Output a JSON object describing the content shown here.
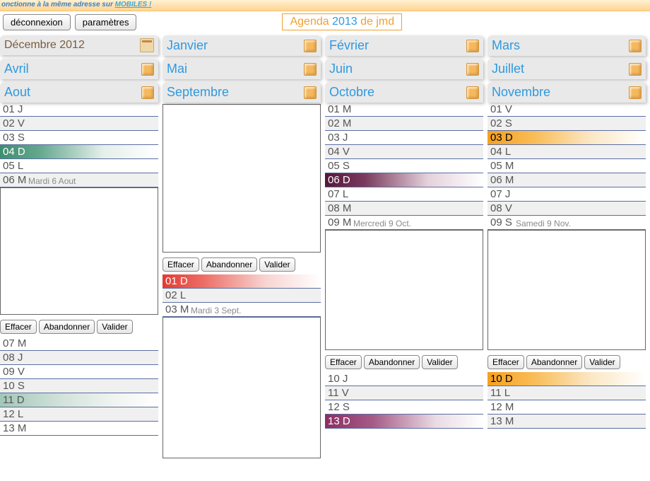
{
  "banner": {
    "prefix": "onctionne à la même adresse sur ",
    "mobiles": "MOBILES !"
  },
  "header": {
    "logout": "déconnexion",
    "settings": "paramètres",
    "title": {
      "t1": "Agenda ",
      "t2": "2013",
      "t3": " de jmd"
    }
  },
  "buttons": {
    "erase": "Effacer",
    "abandon": "Abandonner",
    "validate": "Valider"
  },
  "months_row1": [
    {
      "label": "Décembre 2012",
      "prev": true
    },
    {
      "label": "Janvier"
    },
    {
      "label": "Février"
    },
    {
      "label": "Mars"
    }
  ],
  "months_row2": [
    {
      "label": "Avril"
    },
    {
      "label": "Mai"
    },
    {
      "label": "Juin"
    },
    {
      "label": "Juillet"
    }
  ],
  "col_aout": {
    "label": "Aout",
    "days_top": [
      {
        "n": "01 J"
      },
      {
        "n": "02 V"
      },
      {
        "n": "03 S"
      },
      {
        "n": "04 D",
        "cls": "green"
      },
      {
        "n": "05 L"
      },
      {
        "n": "06 M"
      }
    ],
    "editor_label": "Mardi 6 Aout",
    "textarea_h": 180,
    "days_bottom": [
      {
        "n": "07 M"
      },
      {
        "n": "08 J"
      },
      {
        "n": "09 V"
      },
      {
        "n": "10 S"
      },
      {
        "n": "11 D",
        "cls": "greenlt"
      },
      {
        "n": "12 L"
      },
      {
        "n": "13 M"
      }
    ]
  },
  "col_sept": {
    "label": "Septembre",
    "textarea1_h": 210,
    "days_mid": [
      {
        "n": "01 D",
        "cls": "red"
      },
      {
        "n": "02 L"
      },
      {
        "n": "03 M"
      }
    ],
    "editor_label": "Mardi 3 Sept.",
    "textarea2_h": 200
  },
  "col_oct": {
    "label": "Octobre",
    "days_top": [
      {
        "n": "01 M"
      },
      {
        "n": "02 M"
      },
      {
        "n": "03 J"
      },
      {
        "n": "04 V"
      },
      {
        "n": "05 S"
      },
      {
        "n": "06 D",
        "cls": "purpledk"
      },
      {
        "n": "07 L"
      },
      {
        "n": "08 M"
      },
      {
        "n": "09 M"
      }
    ],
    "editor_label": "Mercredi 9 Oct.",
    "textarea_h": 170,
    "days_bottom": [
      {
        "n": "10 J"
      },
      {
        "n": "11 V"
      },
      {
        "n": "12 S"
      },
      {
        "n": "13 D",
        "cls": "purplelt"
      }
    ]
  },
  "col_nov": {
    "label": "Novembre",
    "days_top": [
      {
        "n": "01 V"
      },
      {
        "n": "02 S"
      },
      {
        "n": "03 D",
        "cls": "orange"
      },
      {
        "n": "04 L"
      },
      {
        "n": "05 M"
      },
      {
        "n": "06 M"
      },
      {
        "n": "07 J"
      },
      {
        "n": "08 V"
      },
      {
        "n": "09 S"
      }
    ],
    "editor_label": "Samedi 9 Nov.",
    "textarea_h": 170,
    "days_bottom": [
      {
        "n": "10 D",
        "cls": "orange"
      },
      {
        "n": "11 L"
      },
      {
        "n": "12 M"
      },
      {
        "n": "13 M"
      }
    ]
  }
}
